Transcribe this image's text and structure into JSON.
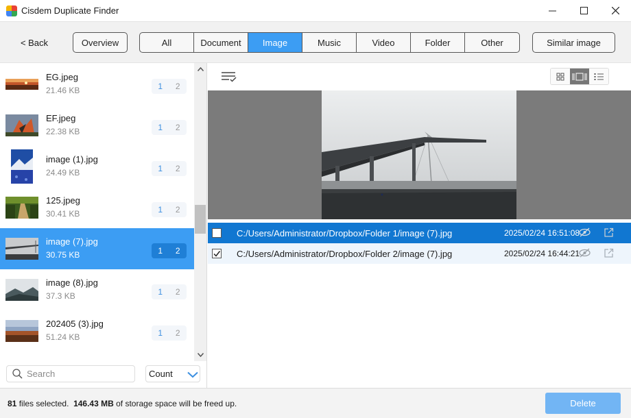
{
  "window": {
    "title": "Cisdem Duplicate Finder",
    "minimize": "—",
    "maximize": "☐",
    "close": "✕"
  },
  "toolbar": {
    "back_label": "< Back",
    "overview_label": "Overview",
    "tabs": [
      "All",
      "Document",
      "Image",
      "Music",
      "Video",
      "Folder",
      "Other"
    ],
    "active_tab": "Image",
    "similar_label": "Similar image"
  },
  "files": [
    {
      "name": "EG.jpeg",
      "size": "21.46 KB",
      "count_a": "1",
      "count_b": "2",
      "thumb": "sunset-city"
    },
    {
      "name": "EF.jpeg",
      "size": "22.38 KB",
      "count_a": "1",
      "count_b": "2",
      "thumb": "butterfly"
    },
    {
      "name": "image (1).jpg",
      "size": "24.49 KB",
      "count_a": "1",
      "count_b": "2",
      "thumb": "blue-mountain"
    },
    {
      "name": "125.jpeg",
      "size": "30.41 KB",
      "count_a": "1",
      "count_b": "2",
      "thumb": "green-path"
    },
    {
      "name": "image (7).jpg",
      "size": "30.75 KB",
      "count_a": "1",
      "count_b": "2",
      "thumb": "foggy-bridge",
      "selected": true
    },
    {
      "name": "image (8).jpg",
      "size": "37.3 KB",
      "count_a": "1",
      "count_b": "2",
      "thumb": "misty-hills"
    },
    {
      "name": "202405 (3).jpg",
      "size": "51.24 KB",
      "count_a": "1",
      "count_b": "2",
      "thumb": "sunset-town"
    }
  ],
  "search": {
    "placeholder": "Search",
    "value": ""
  },
  "sort": {
    "selected": "Count"
  },
  "duplicates": [
    {
      "path": "C:/Users/Administrator/Dropbox/Folder 1/image (7).jpg",
      "date": "2025/02/24 16:51:08",
      "checked": false,
      "selected": true
    },
    {
      "path": "C:/Users/Administrator/Dropbox/Folder 2/image (7).jpg",
      "date": "2025/02/24 16:44:21",
      "checked": true,
      "selected": false
    }
  ],
  "status": {
    "files_count": "81",
    "files_text": "files selected.",
    "size": "146.43 MB",
    "size_text": "of storage space will be freed up."
  },
  "delete_label": "Delete",
  "colors": {
    "accent": "#3c9df3",
    "selected_row": "#1177d1",
    "delete_btn": "#72b5f4"
  }
}
